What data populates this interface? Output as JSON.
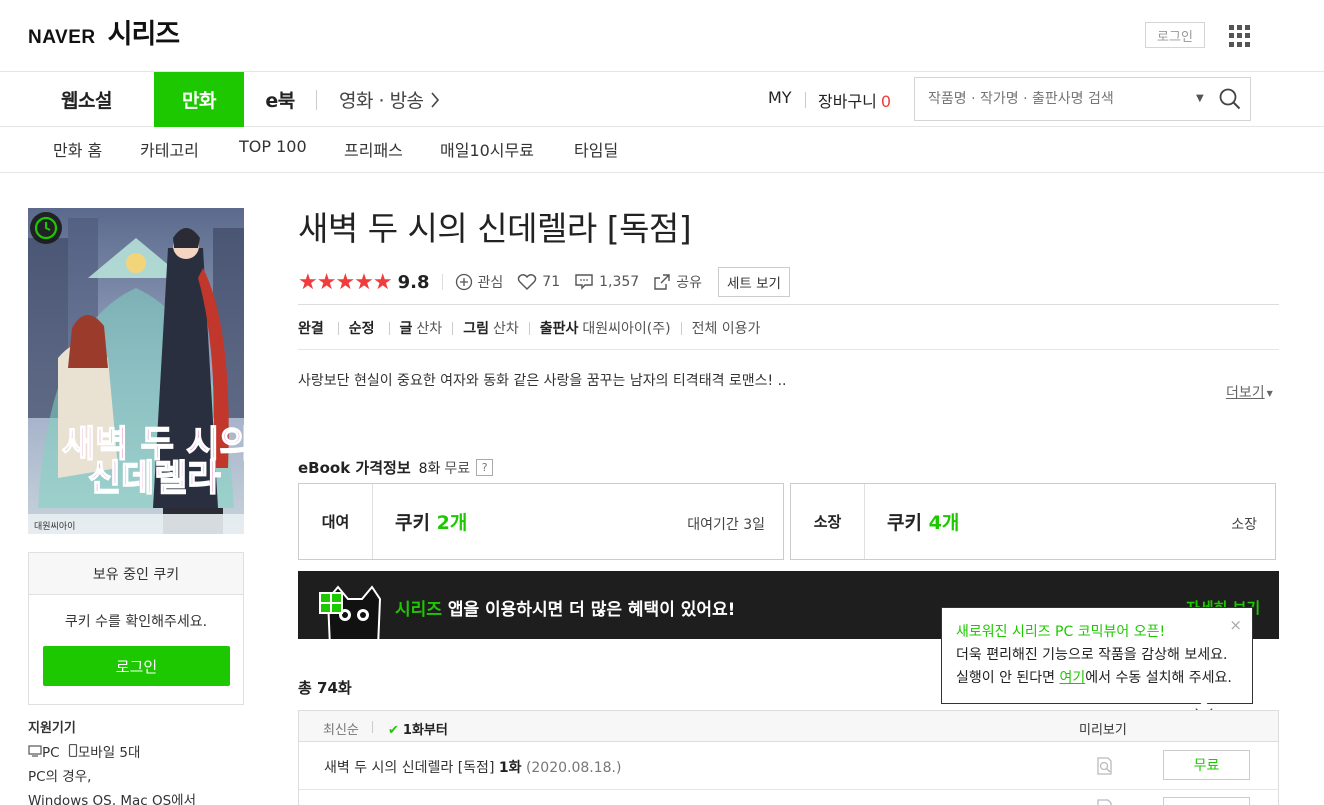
{
  "header": {
    "naver": "NAVER",
    "series": "시리즈",
    "login_small": "로그인"
  },
  "nav": {
    "main": [
      "웹소설",
      "만화",
      "e북",
      "영화 · 방송"
    ],
    "active": "만화",
    "my": "MY",
    "cart_label": "장바구니",
    "cart_count": "0",
    "search_placeholder": "작품명 · 작가명 · 출판사명 검색",
    "sub": [
      "만화 홈",
      "카테고리",
      "TOP 100",
      "프리패스",
      "매일10시무료",
      "타임딜"
    ]
  },
  "sidebar": {
    "cover_title": "새벽 두 시의 신데렐라",
    "cover_publisher": "대원씨아이",
    "cookie_head": "보유 중인 쿠키",
    "cookie_msg": "쿠키 수를 확인해주세요.",
    "login_button": "로그인",
    "devices_title": "지원기기",
    "devices_line1": "PC",
    "devices_line1b": "모바일 5대",
    "devices_line2": "PC의 경우,",
    "devices_line3": "Windows OS, Mac OS에서"
  },
  "product": {
    "title": "새벽 두 시의 신데렐라 [독점]",
    "stars": "★★★★★",
    "score": "9.8",
    "interest": "관심",
    "likes": "71",
    "comments": "1,357",
    "share": "공유",
    "set_view": "세트 보기",
    "meta": {
      "status": "완결",
      "genre": "순정",
      "writer_label": "글",
      "writer": "산차",
      "artist_label": "그림",
      "artist": "산차",
      "publisher_label": "출판사",
      "publisher": "대원씨아이(주)",
      "age": "전체 이용가"
    },
    "description": "사랑보단 현실이 중요한 여자와 동화 같은 사랑을 꿈꾸는 남자의 티격태격 로맨스! ..",
    "more": "더보기"
  },
  "price": {
    "title": "eBook 가격정보",
    "free_count": "8화",
    "free_label": "무료",
    "help": "?",
    "rent_label": "대여",
    "rent_cookie": "쿠키",
    "rent_amount": "2개",
    "rent_note": "대여기간 3일",
    "own_label": "소장",
    "own_cookie": "쿠키",
    "own_amount": "4개",
    "own_note": "소장"
  },
  "banner": {
    "brand": "시리즈",
    "text": " 앱을 이용하시면 더 많은 혜택이 있어요!",
    "detail": "자세히 보기"
  },
  "tooltip": {
    "line1": "새로워진 시리즈 PC 코믹뷰어 오픈!",
    "line2": "더욱 편리해진 기능으로 작품을 감상해 보세요.",
    "line3_pre": "실행이 안 된다면 ",
    "line3_link": "여기",
    "line3_post": "에서 수동 설치해 주세요.",
    "close": "×"
  },
  "episodes": {
    "total": "총 74화",
    "sort_latest": "최신순",
    "sort_first": "1화부터",
    "preview_header": "미리보기",
    "rows": [
      {
        "title": "새벽 두 시의 신데렐라 [독점]",
        "ep": "1화",
        "date": "(2020.08.18.)",
        "button": "무료"
      }
    ],
    "row2_button": "무료"
  },
  "colors": {
    "accent": "#1ec800",
    "star": "#f03c3c",
    "banner_bg": "#1e1e1e"
  }
}
